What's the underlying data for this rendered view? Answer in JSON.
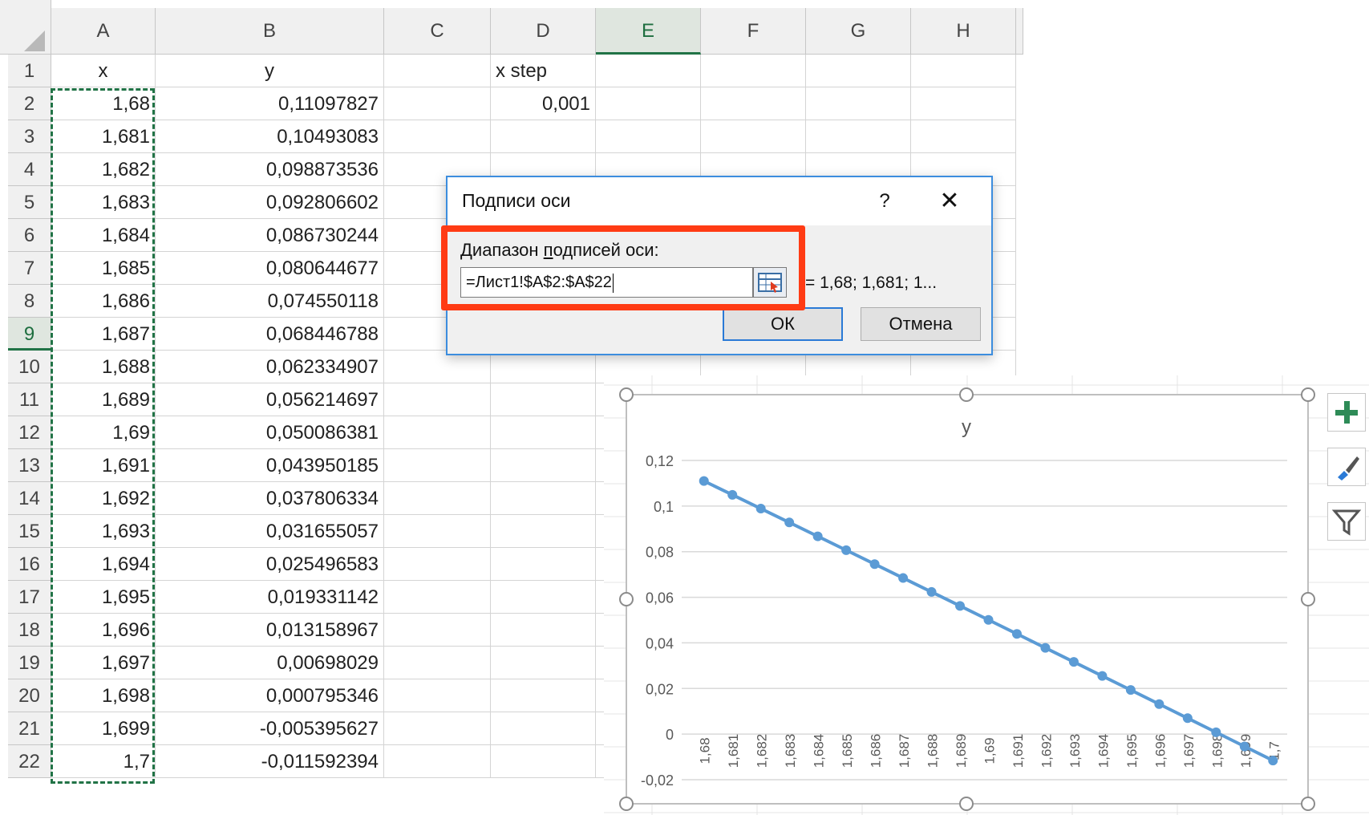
{
  "sheet": {
    "columns": [
      "A",
      "B",
      "C",
      "D",
      "E",
      "F",
      "G",
      "H"
    ],
    "selected_column": "E",
    "selected_row": "9",
    "rows": [
      {
        "n": "1",
        "A": "x",
        "B": "y",
        "C": "",
        "D": "x step"
      },
      {
        "n": "2",
        "A": "1,68",
        "B": "0,11097827",
        "C": "",
        "D": "0,001"
      },
      {
        "n": "3",
        "A": "1,681",
        "B": "0,10493083"
      },
      {
        "n": "4",
        "A": "1,682",
        "B": "0,098873536"
      },
      {
        "n": "5",
        "A": "1,683",
        "B": "0,092806602"
      },
      {
        "n": "6",
        "A": "1,684",
        "B": "0,086730244"
      },
      {
        "n": "7",
        "A": "1,685",
        "B": "0,080644677"
      },
      {
        "n": "8",
        "A": "1,686",
        "B": "0,074550118"
      },
      {
        "n": "9",
        "A": "1,687",
        "B": "0,068446788"
      },
      {
        "n": "10",
        "A": "1,688",
        "B": "0,062334907"
      },
      {
        "n": "11",
        "A": "1,689",
        "B": "0,056214697"
      },
      {
        "n": "12",
        "A": "1,69",
        "B": "0,050086381"
      },
      {
        "n": "13",
        "A": "1,691",
        "B": "0,043950185"
      },
      {
        "n": "14",
        "A": "1,692",
        "B": "0,037806334"
      },
      {
        "n": "15",
        "A": "1,693",
        "B": "0,031655057"
      },
      {
        "n": "16",
        "A": "1,694",
        "B": "0,025496583"
      },
      {
        "n": "17",
        "A": "1,695",
        "B": "0,019331142"
      },
      {
        "n": "18",
        "A": "1,696",
        "B": "0,013158967"
      },
      {
        "n": "19",
        "A": "1,697",
        "B": "0,00698029"
      },
      {
        "n": "20",
        "A": "1,698",
        "B": "0,000795346"
      },
      {
        "n": "21",
        "A": "1,699",
        "B": "-0,005395627"
      },
      {
        "n": "22",
        "A": "1,7",
        "B": "-0,011592394"
      }
    ]
  },
  "dialog": {
    "title": "Подписи оси",
    "help_label": "?",
    "close_label": "✕",
    "range_label_pre": "Диапазон ",
    "range_label_underlined": "п",
    "range_label_post": "одписей оси:",
    "range_value": "=Лист1!$A$2:$A$22",
    "preview": "= 1,68; 1,681; 1...",
    "ok_label": "ОК",
    "cancel_label": "Отмена",
    "highlight_color": "#ff3b14"
  },
  "chart_buttons": {
    "add_icon": "plus-icon",
    "style_icon": "brush-icon",
    "filter_icon": "funnel-icon",
    "accent": "#2e8b57"
  },
  "chart_data": {
    "type": "line",
    "title": "y",
    "series_color": "#5b9bd5",
    "categories": [
      "1,68",
      "1,681",
      "1,682",
      "1,683",
      "1,684",
      "1,685",
      "1,686",
      "1,687",
      "1,688",
      "1,689",
      "1,69",
      "1,691",
      "1,692",
      "1,693",
      "1,694",
      "1,695",
      "1,696",
      "1,697",
      "1,698",
      "1,699",
      "1,7"
    ],
    "values": [
      0.11097827,
      0.10493083,
      0.098873536,
      0.092806602,
      0.086730244,
      0.080644677,
      0.074550118,
      0.068446788,
      0.062334907,
      0.056214697,
      0.050086381,
      0.043950185,
      0.037806334,
      0.031655057,
      0.025496583,
      0.019331142,
      0.013158967,
      0.00698029,
      0.000795346,
      -0.005395627,
      -0.011592394
    ],
    "ylim": [
      -0.02,
      0.12
    ],
    "y_ticks": [
      "0,12",
      "0,1",
      "0,08",
      "0,06",
      "0,04",
      "0,02",
      "0",
      "-0,02"
    ],
    "y_tick_values": [
      0.12,
      0.1,
      0.08,
      0.06,
      0.04,
      0.02,
      0,
      -0.02
    ],
    "grid": true
  }
}
